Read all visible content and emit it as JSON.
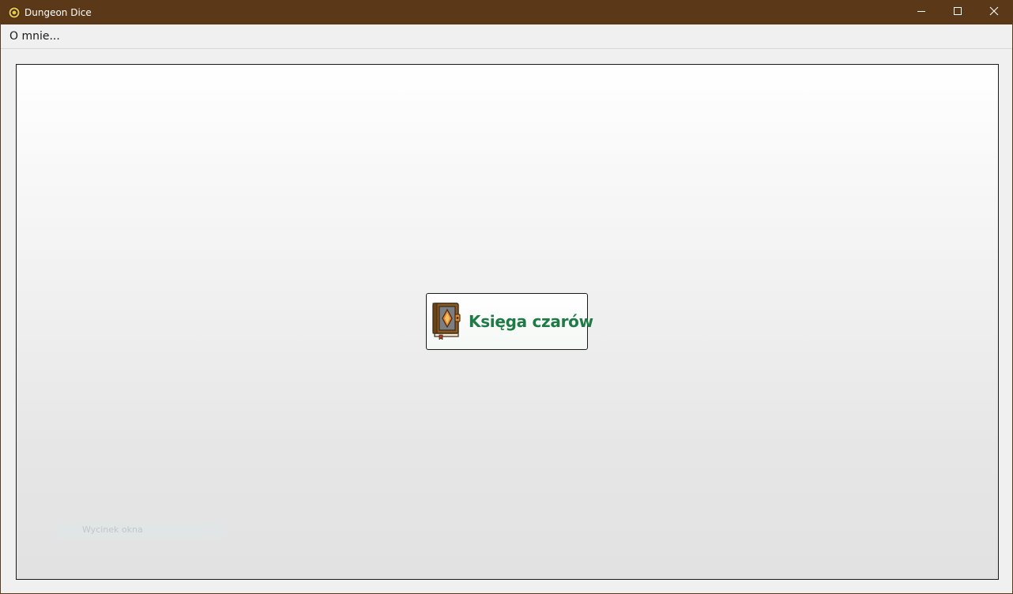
{
  "window": {
    "title": "Dungeon Dice",
    "app_icon": "dice-gear-icon",
    "controls": {
      "minimize": "minimize-icon",
      "maximize": "maximize-icon",
      "close": "close-icon"
    }
  },
  "menubar": {
    "items": [
      {
        "label": "O mnie..."
      }
    ]
  },
  "main": {
    "spellbook_button": {
      "label": "Księga czarów",
      "icon": "spellbook-icon",
      "label_color": "#1f7a45"
    },
    "snip_overlay": {
      "label": "Wycinek okna"
    }
  },
  "colors": {
    "titlebar": "#5a3818",
    "accent_green": "#1f7a45"
  }
}
